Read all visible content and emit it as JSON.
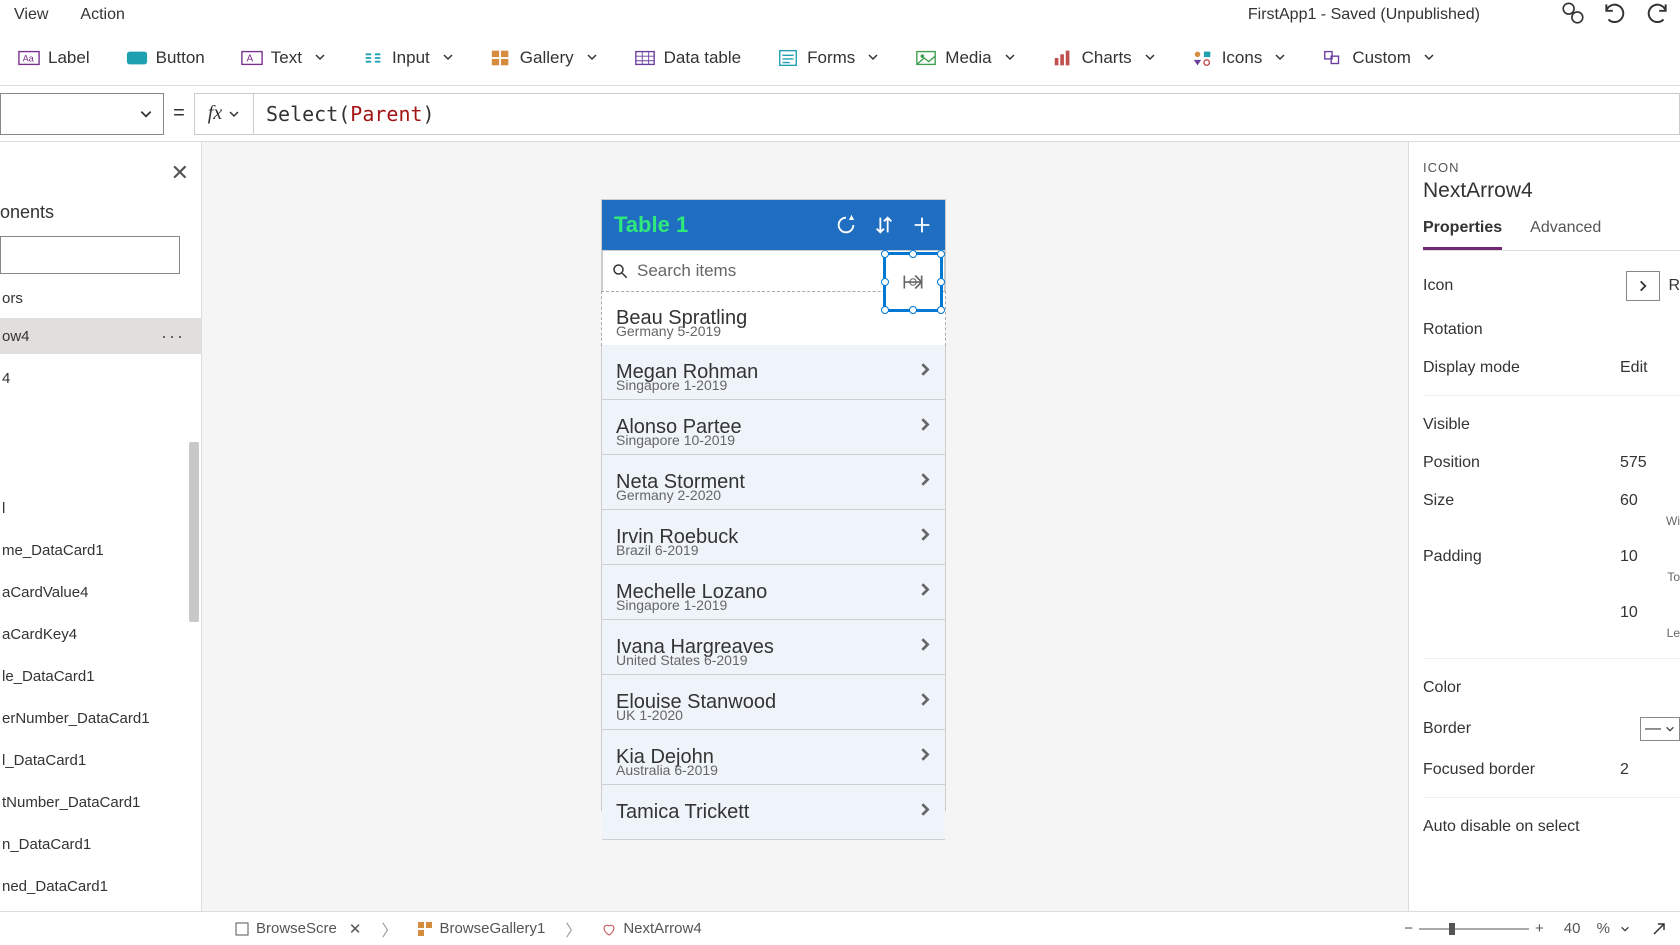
{
  "menu": {
    "view": "View",
    "action": "Action"
  },
  "app_title": "FirstApp1 - Saved (Unpublished)",
  "insert": {
    "label": "Label",
    "button": "Button",
    "text": "Text",
    "input": "Input",
    "gallery": "Gallery",
    "datatable": "Data table",
    "forms": "Forms",
    "media": "Media",
    "charts": "Charts",
    "icons": "Icons",
    "custom": "Custom"
  },
  "formula": {
    "fn": "Select",
    "arg": "Parent"
  },
  "left_panel": {
    "tab": "onents",
    "truncated_top": "ors",
    "selected": "ow4",
    "below_selected": "4",
    "items": [
      "l",
      "me_DataCard1",
      "aCardValue4",
      "aCardKey4",
      "le_DataCard1",
      "erNumber_DataCard1",
      "l_DataCard1",
      "tNumber_DataCard1",
      "n_DataCard1",
      "ned_DataCard1"
    ]
  },
  "phone": {
    "title": "Table 1",
    "search_placeholder": "Search items",
    "rows": [
      {
        "name": "Beau Spratling",
        "sub": "Germany 5-2019"
      },
      {
        "name": "Megan Rohman",
        "sub": "Singapore 1-2019"
      },
      {
        "name": "Alonso Partee",
        "sub": "Singapore 10-2019"
      },
      {
        "name": "Neta Storment",
        "sub": "Germany 2-2020"
      },
      {
        "name": "Irvin Roebuck",
        "sub": "Brazil 6-2019"
      },
      {
        "name": "Mechelle Lozano",
        "sub": "Singapore 1-2019"
      },
      {
        "name": "Ivana Hargreaves",
        "sub": "United States 6-2019"
      },
      {
        "name": "Elouise Stanwood",
        "sub": "UK 1-2020"
      },
      {
        "name": "Kia Dejohn",
        "sub": "Australia 6-2019"
      },
      {
        "name": "Tamica Trickett",
        "sub": ""
      }
    ]
  },
  "right": {
    "type": "ICON",
    "name": "NextArrow4",
    "tab_props": "Properties",
    "tab_adv": "Advanced",
    "props": {
      "icon": "Icon",
      "icon_val": "R",
      "rotation": "Rotation",
      "display_mode": "Display mode",
      "display_mode_val": "Edit",
      "visible": "Visible",
      "position": "Position",
      "position_x": "575",
      "size": "Size",
      "size_w": "60",
      "size_wlabel": "Wi",
      "padding": "Padding",
      "padding_t": "10",
      "padding_tlabel": "To",
      "padding_l": "10",
      "padding_llabel": "Le",
      "color": "Color",
      "border": "Border",
      "focused_border": "Focused border",
      "focused_border_val": "2",
      "auto_disable": "Auto disable on select"
    }
  },
  "status": {
    "screen": "BrowseScre",
    "gallery": "BrowseGallery1",
    "nextarrow": "NextArrow4",
    "zoom": "40",
    "pct": "%"
  }
}
